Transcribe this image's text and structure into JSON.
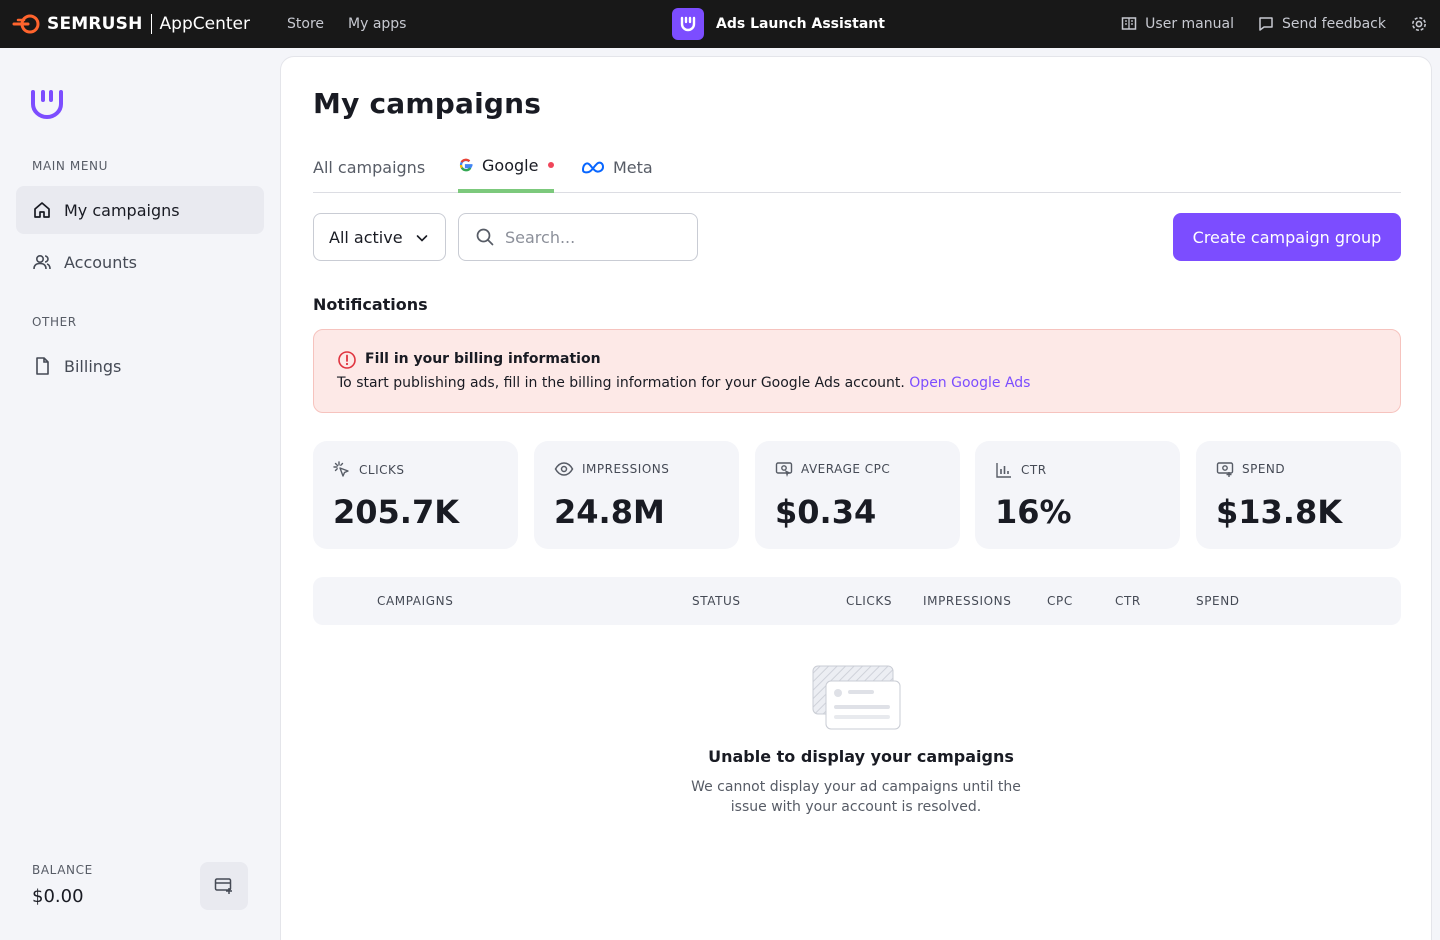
{
  "topbar": {
    "brand_name": "SEMRUSH",
    "brand_app": "AppCenter",
    "nav": [
      "Store",
      "My apps"
    ],
    "app_title": "Ads Launch Assistant",
    "user_manual": "User manual",
    "send_feedback": "Send feedback"
  },
  "sidebar": {
    "main_menu_label": "MAIN MENU",
    "items": [
      {
        "label": "My campaigns"
      },
      {
        "label": "Accounts"
      }
    ],
    "other_label": "OTHER",
    "other_items": [
      {
        "label": "Billings"
      }
    ],
    "balance_label": "BALANCE",
    "balance_value": "$0.00"
  },
  "main": {
    "title": "My campaigns",
    "tabs": [
      {
        "label": "All campaigns"
      },
      {
        "label": "Google"
      },
      {
        "label": "Meta"
      }
    ],
    "filter_value": "All active",
    "search_placeholder": "Search...",
    "create_button": "Create campaign group",
    "notifications_heading": "Notifications",
    "alert": {
      "title": "Fill in your billing information",
      "body": "To start publishing ads, fill in the billing information for your Google Ads account.",
      "link": "Open Google Ads"
    },
    "stats": [
      {
        "label": "CLICKS",
        "value": "205.7K"
      },
      {
        "label": "IMPRESSIONS",
        "value": "24.8M"
      },
      {
        "label": "AVERAGE CPC",
        "value": "$0.34"
      },
      {
        "label": "CTR",
        "value": "16%"
      },
      {
        "label": "SPEND",
        "value": "$13.8K"
      }
    ],
    "table_headers": [
      "CAMPAIGNS",
      "STATUS",
      "CLICKS",
      "IMPRESSIONS",
      "CPC",
      "CTR",
      "SPEND"
    ],
    "empty": {
      "title": "Unable to display your campaigns",
      "description": "We cannot display your ad campaigns until the issue with your account is resolved."
    }
  },
  "colors": {
    "accent": "#7c4dff",
    "topbar": "#181818",
    "alert_bg": "#fde9e7",
    "tab_underline": "#7cc97c"
  }
}
